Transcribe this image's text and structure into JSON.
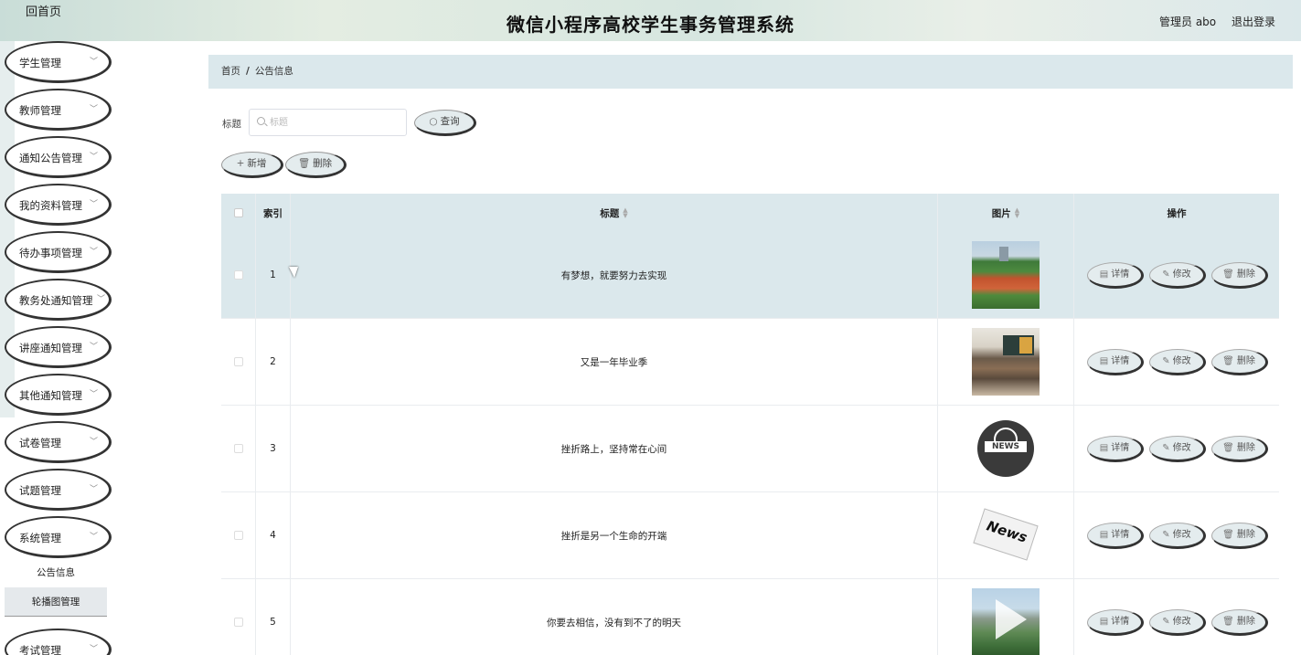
{
  "header": {
    "home_label": "回首页",
    "title": "微信小程序高校学生事务管理系统",
    "user": "管理员 abo",
    "logout": "退出登录"
  },
  "sidebar": {
    "items": [
      {
        "label": "学生管理"
      },
      {
        "label": "教师管理"
      },
      {
        "label": "通知公告管理"
      },
      {
        "label": "我的资料管理"
      },
      {
        "label": "待办事项管理"
      },
      {
        "label": "教务处通知管理"
      },
      {
        "label": "讲座通知管理"
      },
      {
        "label": "其他通知管理"
      },
      {
        "label": "试卷管理"
      },
      {
        "label": "试题管理"
      },
      {
        "label": "系统管理"
      },
      {
        "label": "考试管理"
      }
    ],
    "sub_items": [
      {
        "label": "公告信息"
      },
      {
        "label": "轮播图管理"
      }
    ]
  },
  "breadcrumb": {
    "home": "首页",
    "sep": "/",
    "current": "公告信息"
  },
  "search": {
    "label": "标题",
    "placeholder": "标题",
    "value": "",
    "button": "查询"
  },
  "toolbar": {
    "add": "新增",
    "delete": "删除"
  },
  "table": {
    "columns": {
      "index": "索引",
      "title": "标题",
      "image": "图片",
      "actions": "操作"
    },
    "actions": {
      "detail": "详情",
      "edit": "修改",
      "delete": "删除"
    },
    "rows": [
      {
        "index": "1",
        "title": "有梦想，就要努力去实现",
        "image": "sports-field-photo"
      },
      {
        "index": "2",
        "title": "又是一年毕业季",
        "image": "classroom-photo"
      },
      {
        "index": "3",
        "title": "挫折路上，坚持常在心间",
        "image": "news-globe-icon"
      },
      {
        "index": "4",
        "title": "挫折是另一个生命的开端",
        "image": "newspaper-icon"
      },
      {
        "index": "5",
        "title": "你要去相信，没有到不了的明天",
        "image": "campus-photo"
      }
    ]
  },
  "colors": {
    "accent_bg": "#dbe8ec",
    "button_bg": "#e4ecee"
  }
}
